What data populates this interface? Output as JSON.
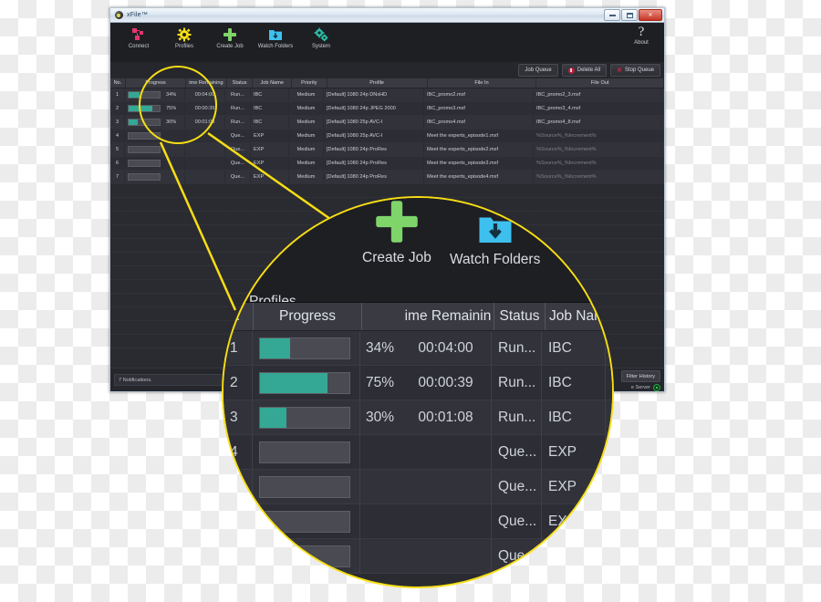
{
  "window": {
    "title": "xFile™",
    "minimize_label": "Minimize",
    "maximize_label": "Maximize",
    "close_label": "✕"
  },
  "toolbar": {
    "items": [
      {
        "label": "Connect",
        "icon": "network-nodes-icon",
        "color": "#e8356d"
      },
      {
        "label": "Profiles",
        "icon": "gear-icon",
        "color": "#f7de13"
      },
      {
        "label": "Create Job",
        "icon": "plus-icon",
        "color": "#7fd46a"
      },
      {
        "label": "Watch Folders",
        "icon": "folder-download-icon",
        "color": "#3ec0ef"
      },
      {
        "label": "System",
        "icon": "double-gear-icon",
        "color": "#2bbfa6"
      }
    ],
    "about_label": "About",
    "about_icon": "question-mark-icon"
  },
  "queue_bar": {
    "job_queue_label": "Job Queue",
    "delete_all_label": "Delete All",
    "stop_queue_label": "Stop Queue"
  },
  "table": {
    "columns": [
      "No.",
      "Progress",
      "ime Remaining",
      "Status",
      "Job Name",
      "Priority",
      "Profile",
      "File In",
      "File Out"
    ],
    "rows": [
      {
        "no": "1",
        "progress_pct": 34,
        "progress_label": "34%",
        "remaining": "00:04:00",
        "status": "Run...",
        "job_name": "IBC",
        "priority": "Medium",
        "profile": "[Default] 1080 24p DNxHD",
        "file_in": "IBC_promo2.mxf",
        "file_out": "IBC_promo2_3.mxf"
      },
      {
        "no": "2",
        "progress_pct": 75,
        "progress_label": "75%",
        "remaining": "00:00:39",
        "status": "Run...",
        "job_name": "IBC",
        "priority": "Medium",
        "profile": "[Default] 1080 24p JPEG 2000",
        "file_in": "IBC_promo3.mxf",
        "file_out": "IBC_promo3_4.mxf"
      },
      {
        "no": "3",
        "progress_pct": 30,
        "progress_label": "30%",
        "remaining": "00:01:08",
        "status": "Run...",
        "job_name": "IBC",
        "priority": "Medium",
        "profile": "[Default] 1080 25p AVC-I",
        "file_in": "IBC_promo4.mxf",
        "file_out": "IBC_promo4_8.mxf"
      },
      {
        "no": "4",
        "progress_pct": 0,
        "progress_label": "",
        "remaining": "",
        "status": "Que...",
        "job_name": "EXP",
        "priority": "Medium",
        "profile": "[Default] 1080 25p AVC-I",
        "file_in": "Meet the experts_episode1.mxf",
        "file_out": "%Source%_%Increment%"
      },
      {
        "no": "5",
        "progress_pct": 0,
        "progress_label": "",
        "remaining": "",
        "status": "Que...",
        "job_name": "EXP",
        "priority": "Medium",
        "profile": "[Default] 1080 24p ProRes",
        "file_in": "Meet the experts_episode2.mxf",
        "file_out": "%Source%_%Increment%"
      },
      {
        "no": "6",
        "progress_pct": 0,
        "progress_label": "",
        "remaining": "",
        "status": "Que...",
        "job_name": "EXP",
        "priority": "Medium",
        "profile": "[Default] 1080 24p ProRes",
        "file_in": "Meet the experts_episode3.mxf",
        "file_out": "%Source%_%Increment%"
      },
      {
        "no": "7",
        "progress_pct": 0,
        "progress_label": "",
        "remaining": "",
        "status": "Que...",
        "job_name": "EXP",
        "priority": "Medium",
        "profile": "[Default] 1080 24p ProRes",
        "file_in": "Meet the experts_episode4.mxf",
        "file_out": "%Source%_%Increment%"
      }
    ]
  },
  "status_bar": {
    "notifications": "7 Notifications.",
    "filter_history_label": "Filter History",
    "server_label": "e Server",
    "server_status_icon": "green-power-icon"
  },
  "magnifier": {
    "toolbar_items": [
      {
        "label": "Profiles",
        "icon": "gear-icon"
      },
      {
        "label": "Create Job",
        "icon": "plus-icon"
      },
      {
        "label": "Watch Folders",
        "icon": "folder-download-icon"
      }
    ],
    "columns": [
      ".",
      "Progress",
      "",
      "ime Remainin",
      "Status",
      "Job Nam"
    ],
    "rows": [
      {
        "no": "1",
        "progress_pct": 34,
        "progress_label": "34%",
        "remaining": "00:04:00",
        "status": "Run...",
        "job_name": "IBC"
      },
      {
        "no": "2",
        "progress_pct": 75,
        "progress_label": "75%",
        "remaining": "00:00:39",
        "status": "Run...",
        "job_name": "IBC"
      },
      {
        "no": "3",
        "progress_pct": 30,
        "progress_label": "30%",
        "remaining": "00:01:08",
        "status": "Run...",
        "job_name": "IBC"
      },
      {
        "no": "4",
        "progress_pct": 0,
        "progress_label": "",
        "remaining": "",
        "status": "Que...",
        "job_name": "EXP"
      },
      {
        "no": "",
        "progress_pct": 0,
        "progress_label": "",
        "remaining": "",
        "status": "Que...",
        "job_name": "EXP"
      },
      {
        "no": "",
        "progress_pct": 0,
        "progress_label": "",
        "remaining": "",
        "status": "Que...",
        "job_name": "EXP"
      },
      {
        "no": "",
        "progress_pct": 0,
        "progress_label": "",
        "remaining": "",
        "status": "Que",
        "job_name": ""
      }
    ]
  },
  "colors": {
    "accent_yellow": "#f7de13",
    "progress_teal": "#34a894",
    "panel_dark": "#2a2b30",
    "toolbar_dark": "#1e1f23",
    "header_gray": "#3a3b42",
    "danger_red": "#cf2742"
  }
}
